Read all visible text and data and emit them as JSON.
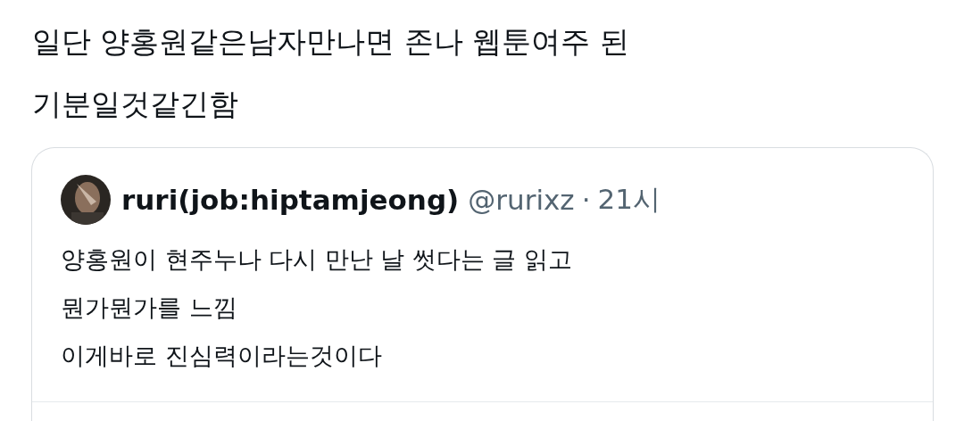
{
  "post": {
    "text_lines": [
      "일단 양홍원같은남자만나면 존나 웹툰여주 된",
      "기분일것같긴함"
    ]
  },
  "quoted_post": {
    "display_name": "ruri(job:hiptamjeong)",
    "handle": "@rurixz",
    "separator": "·",
    "time": "21시",
    "text_lines": [
      "양홍원이 현주누나 다시 만난 날 썻다는 글 읽고",
      "뭔가뭔가를 느낌",
      "이게바로 진심력이라는것이다"
    ]
  }
}
